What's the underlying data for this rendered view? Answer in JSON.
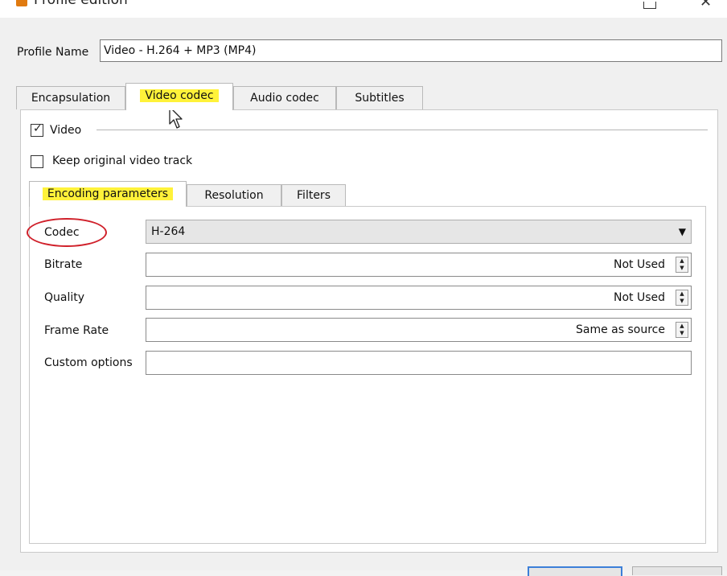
{
  "window": {
    "title": "Profile edition"
  },
  "profile": {
    "label": "Profile Name",
    "value": "Video - H.264 + MP3 (MP4)"
  },
  "tabs": [
    {
      "label": "Encapsulation",
      "active": false
    },
    {
      "label": "Video codec",
      "active": true,
      "highlighted": true
    },
    {
      "label": "Audio codec",
      "active": false
    },
    {
      "label": "Subtitles",
      "active": false
    }
  ],
  "video_group": {
    "video_label": "Video",
    "video_checked": true,
    "keep_original_label": "Keep original video track",
    "keep_original_checked": false
  },
  "inner_tabs": [
    {
      "label": "Encoding parameters",
      "active": true,
      "highlighted": true
    },
    {
      "label": "Resolution",
      "active": false
    },
    {
      "label": "Filters",
      "active": false
    }
  ],
  "fields": {
    "codec": {
      "label": "Codec",
      "value": "H-264"
    },
    "bitrate": {
      "label": "Bitrate",
      "value": "Not Used"
    },
    "quality": {
      "label": "Quality",
      "value": "Not Used"
    },
    "frame_rate": {
      "label": "Frame Rate",
      "value": "Same as source"
    },
    "custom_options": {
      "label": "Custom options",
      "value": ""
    }
  },
  "colors": {
    "highlight": "#fff23a",
    "annotation_circle": "#d0202a",
    "primary_button_border": "#3c7fd8"
  }
}
